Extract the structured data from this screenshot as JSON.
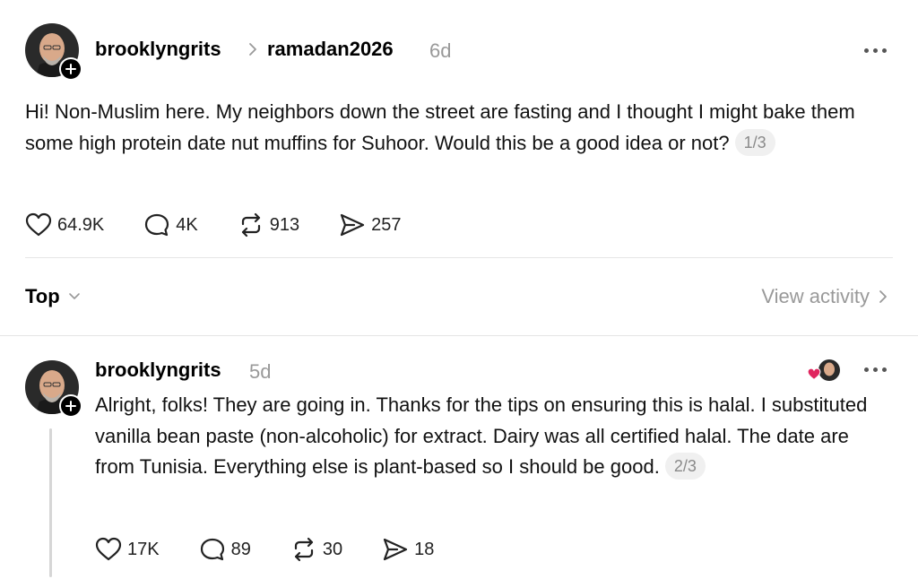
{
  "post": {
    "username": "brooklyngrits",
    "community": "ramadan2026",
    "time": "6d",
    "body": "Hi! Non-Muslim here. My neighbors down the street are fasting and I thought I might bake them some high protein date nut muffins for Suhoor. Would this be a good idea or not?",
    "page_badge": "1/3",
    "likes": "64.9K",
    "replies": "4K",
    "reposts": "913",
    "shares": "257"
  },
  "sort_bar": {
    "sort_label": "Top",
    "view_activity_label": "View activity"
  },
  "reply": {
    "username": "brooklyngrits",
    "time": "5d",
    "body": "Alright, folks! They are going in. Thanks for the tips on ensuring this is halal. I substituted vanilla bean paste (non-alcoholic) for extract. Dairy was all certified halal. The date are from Tunisia. Everything else is plant-based so I should be good.",
    "page_badge": "2/3",
    "likes": "17K",
    "replies": "89",
    "reposts": "30",
    "shares": "18"
  },
  "colors": {
    "muted": "#999999",
    "like_heart": "#e0245e",
    "divider": "#e5e5e5"
  }
}
